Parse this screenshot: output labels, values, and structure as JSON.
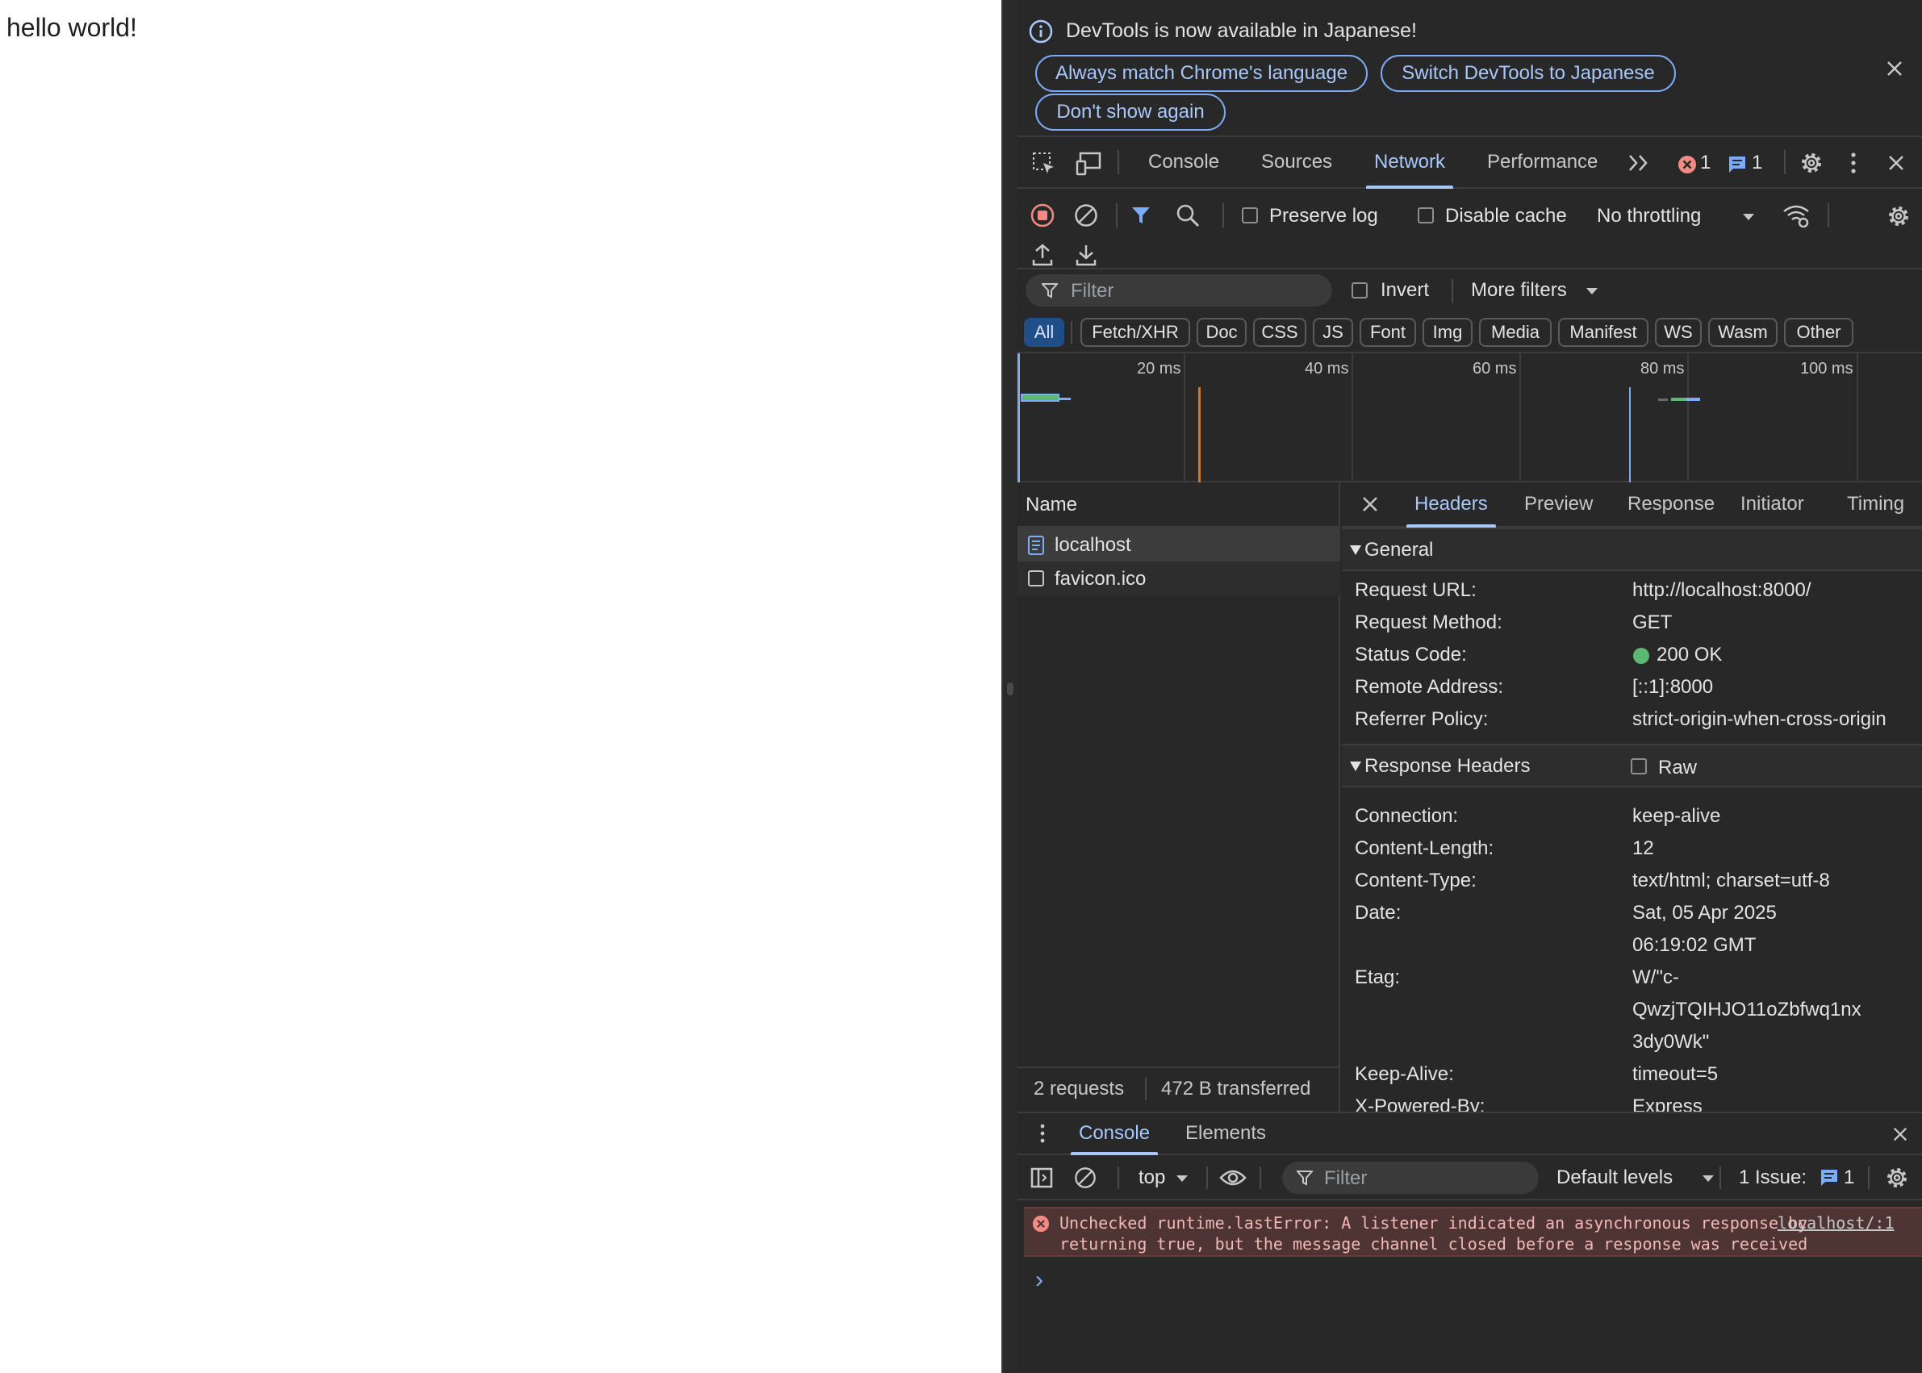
{
  "page": {
    "body_text": "hello world!"
  },
  "infobar": {
    "message": "DevTools is now available in Japanese!",
    "buttons": [
      "Always match Chrome's language",
      "Switch DevTools to Japanese",
      "Don't show again"
    ]
  },
  "main_tabs": {
    "tabs": [
      "Console",
      "Sources",
      "Network",
      "Performance"
    ],
    "active": "Network",
    "error_count": "1",
    "message_count": "1"
  },
  "network_toolbar": {
    "preserve_log": "Preserve log",
    "disable_cache": "Disable cache",
    "throttling": "No throttling"
  },
  "filter": {
    "placeholder": "Filter",
    "invert": "Invert",
    "more_filters": "More filters",
    "types": [
      "All",
      "Fetch/XHR",
      "Doc",
      "CSS",
      "JS",
      "Font",
      "Img",
      "Media",
      "Manifest",
      "WS",
      "Wasm",
      "Other"
    ],
    "active_type": "All"
  },
  "overview": {
    "ticks": [
      "20 ms",
      "40 ms",
      "60 ms",
      "80 ms",
      "100 ms"
    ]
  },
  "request_list": {
    "column": "Name",
    "requests": [
      {
        "name": "localhost",
        "type": "document"
      },
      {
        "name": "favicon.ico",
        "type": "other"
      }
    ],
    "summary_requests": "2 requests",
    "summary_transferred": "472 B transferred"
  },
  "details": {
    "tabs": [
      "Headers",
      "Preview",
      "Response",
      "Initiator",
      "Timing"
    ],
    "active_tab": "Headers",
    "general_title": "General",
    "general": [
      {
        "key": "Request URL:",
        "value": "http://localhost:8000/"
      },
      {
        "key": "Request Method:",
        "value": "GET"
      },
      {
        "key": "Status Code:",
        "value": "200 OK"
      },
      {
        "key": "Remote Address:",
        "value": "[::1]:8000"
      },
      {
        "key": "Referrer Policy:",
        "value": "strict-origin-when-cross-origin"
      }
    ],
    "response_title": "Response Headers",
    "raw_label": "Raw",
    "response_headers": [
      {
        "key": "Connection:",
        "value": "keep-alive"
      },
      {
        "key": "Content-Length:",
        "value": "12"
      },
      {
        "key": "Content-Type:",
        "value": "text/html; charset=utf-8"
      },
      {
        "key": "Date:",
        "value_lines": [
          "Sat, 05 Apr 2025",
          "06:19:02 GMT"
        ]
      },
      {
        "key": "Etag:",
        "value_lines": [
          "W/\"c-",
          "QwzjTQIHJO11oZbfwq1nx",
          "3dy0Wk\""
        ]
      },
      {
        "key": "Keep-Alive:",
        "value": "timeout=5"
      },
      {
        "key": "X-Powered-By:",
        "value": "Express"
      }
    ]
  },
  "drawer": {
    "tabs": [
      "Console",
      "Elements"
    ],
    "active_tab": "Console",
    "context": "top",
    "filter_placeholder": "Filter",
    "levels": "Default levels",
    "issues_label": "1 Issue:",
    "issues_count": "1",
    "error_line1": "Unchecked runtime.lastError: A listener indicated an asynchronous response by",
    "error_line2": "returning true, but the message channel closed before a response was received",
    "error_source": "localhost/:1",
    "prompt": "›"
  },
  "colors": {
    "accent": "#a8c7fa",
    "background": "#282828",
    "error_bg": "#4e3534",
    "error_red": "#f28b82",
    "status_green": "#5bb974"
  },
  "icons": [
    "info-icon",
    "close-icon",
    "element-picker-icon",
    "device-toolbar-icon",
    "more-tabs-icon",
    "error-icon",
    "message-icon",
    "settings-icon",
    "kebab-menu-icon",
    "record-icon",
    "clear-icon",
    "filter-icon",
    "search-icon",
    "wifi-settings-icon",
    "upload-icon",
    "download-icon",
    "document-icon",
    "sidebar-toggle-icon",
    "eye-icon",
    "chevron-down-icon"
  ]
}
